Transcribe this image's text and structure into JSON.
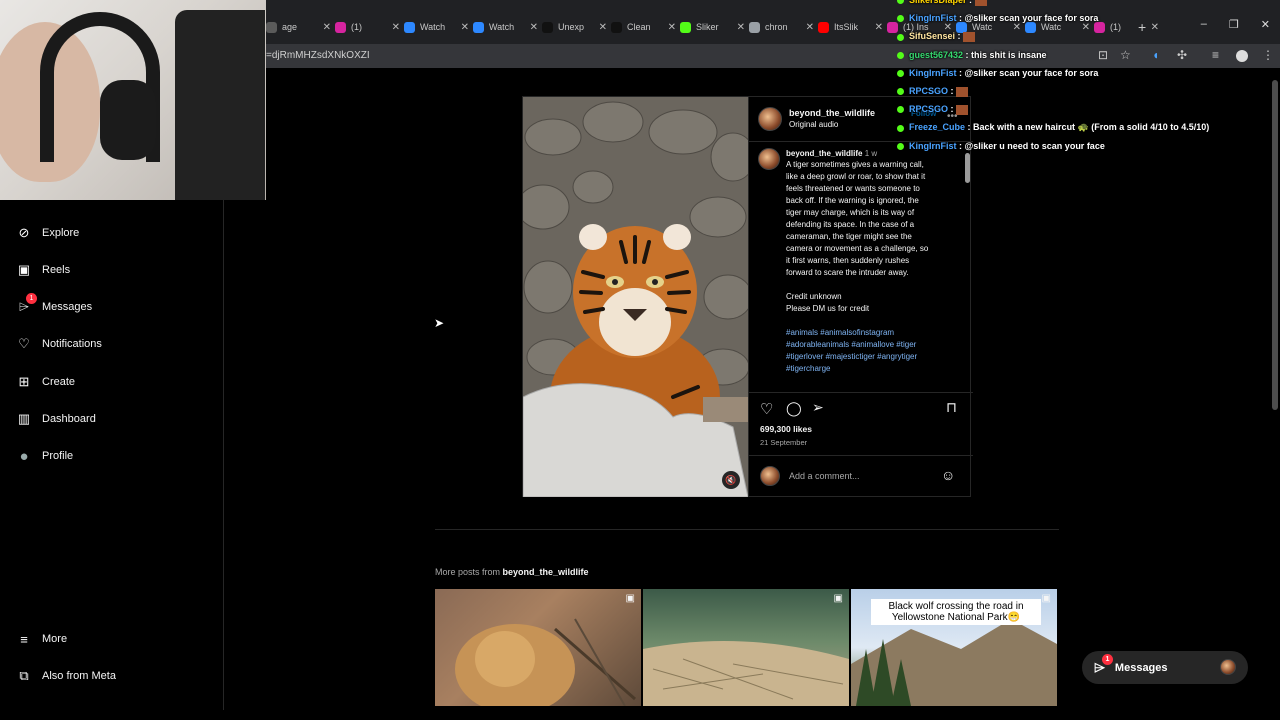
{
  "browser": {
    "tabs": [
      {
        "label": "age",
        "fav": "#5b5b5b"
      },
      {
        "label": "(1)",
        "fav": "#d6249f"
      },
      {
        "label": "Watch",
        "fav": "#2d88ff"
      },
      {
        "label": "Watch",
        "fav": "#2d88ff"
      },
      {
        "label": "Unexp",
        "fav": "#111111"
      },
      {
        "label": "Clean",
        "fav": "#111111"
      },
      {
        "label": "Sliker",
        "fav": "#53fc18"
      },
      {
        "label": "chron",
        "fav": "#9aa0a6"
      },
      {
        "label": "ItsSlik",
        "fav": "#ff0000"
      },
      {
        "label": "(1) Ins",
        "fav": "#d6249f"
      },
      {
        "label": "Watc",
        "fav": "#2d88ff"
      },
      {
        "label": "Watc",
        "fav": "#2d88ff"
      },
      {
        "label": "(1)",
        "fav": "#d6249f"
      }
    ],
    "url": "=djRmMHZsdXNkOXZI",
    "new_tab": "+",
    "minimize": "–",
    "restore": "❐",
    "close": "✕"
  },
  "sidebar": {
    "items": [
      {
        "label": "Explore",
        "icon": "compass-icon",
        "glyph": "⊘"
      },
      {
        "label": "Reels",
        "icon": "reels-icon",
        "glyph": "▣"
      },
      {
        "label": "Messages",
        "icon": "messenger-icon",
        "glyph": "⌲",
        "badge": "1"
      },
      {
        "label": "Notifications",
        "icon": "heart-icon",
        "glyph": "♡"
      },
      {
        "label": "Create",
        "icon": "plus-square-icon",
        "glyph": "⊞"
      },
      {
        "label": "Dashboard",
        "icon": "chart-icon",
        "glyph": "▥"
      },
      {
        "label": "Profile",
        "icon": "avatar-icon",
        "glyph": "●"
      }
    ],
    "more": "More",
    "also_from_meta": "Also from Meta"
  },
  "post": {
    "username": "beyond_the_wildlife",
    "audio": "Original audio",
    "follow": "Follow",
    "caption_username": "beyond_the_wildlife",
    "caption_time": "1 w",
    "caption_lines": [
      "A tiger sometimes gives a warning call,",
      "like a deep growl or roar, to show that it",
      "feels threatened or wants someone to",
      "back off. If the warning is ignored, the",
      "tiger may charge, which is its way of",
      "defending its space. In the case of a",
      "cameraman, the tiger might see the",
      "camera or movement as a challenge, so",
      "it first warns, then suddenly rushes",
      "forward to scare the intruder away."
    ],
    "credit1": "Credit unknown",
    "credit2": "Please DM us for credit",
    "hashtags_lines": [
      "#animals #animalsofinstagram",
      "#adorableanimals #animallove #tiger",
      "#tigerlover #majestictiger #angrytiger",
      "#tigercharge"
    ],
    "likes": "699,300 likes",
    "date": "21 September",
    "comment_placeholder": "Add a comment..."
  },
  "more_posts": {
    "prefix": "More posts from ",
    "user": "beyond_the_wildlife",
    "thumb3_caption": "Black wolf crossing the road in Yellowstone National Park😁"
  },
  "chat": [
    {
      "user": "SlikersDiaper",
      "msg": "",
      "color": "#ffd400"
    },
    {
      "user": "KingIrnFist",
      "msg": "@sliker scan your face for sora",
      "color": "#4aa3ff"
    },
    {
      "user": "SifuSensei",
      "msg": "",
      "color": "#ffe5a0"
    },
    {
      "user": "guest567432",
      "msg": "this shit is insane",
      "color": "#36d86f"
    },
    {
      "user": "KingIrnFist",
      "msg": "@sliker scan your face for sora",
      "color": "#4aa3ff"
    },
    {
      "user": "RPCSGO",
      "msg": "",
      "color": "#4aa3ff"
    },
    {
      "user": "RPCSGO",
      "msg": "",
      "color": "#4aa3ff"
    },
    {
      "user": "Freeze_Cube",
      "msg": "Back with a new haircut 🐢 (From a solid 4/10 to 4.5/10)",
      "color": "#4aa3ff"
    },
    {
      "user": "KingIrnFist",
      "msg": "@sliker u need to scan your face",
      "color": "#4aa3ff"
    }
  ],
  "messages_pill": {
    "label": "Messages",
    "badge": "1"
  }
}
